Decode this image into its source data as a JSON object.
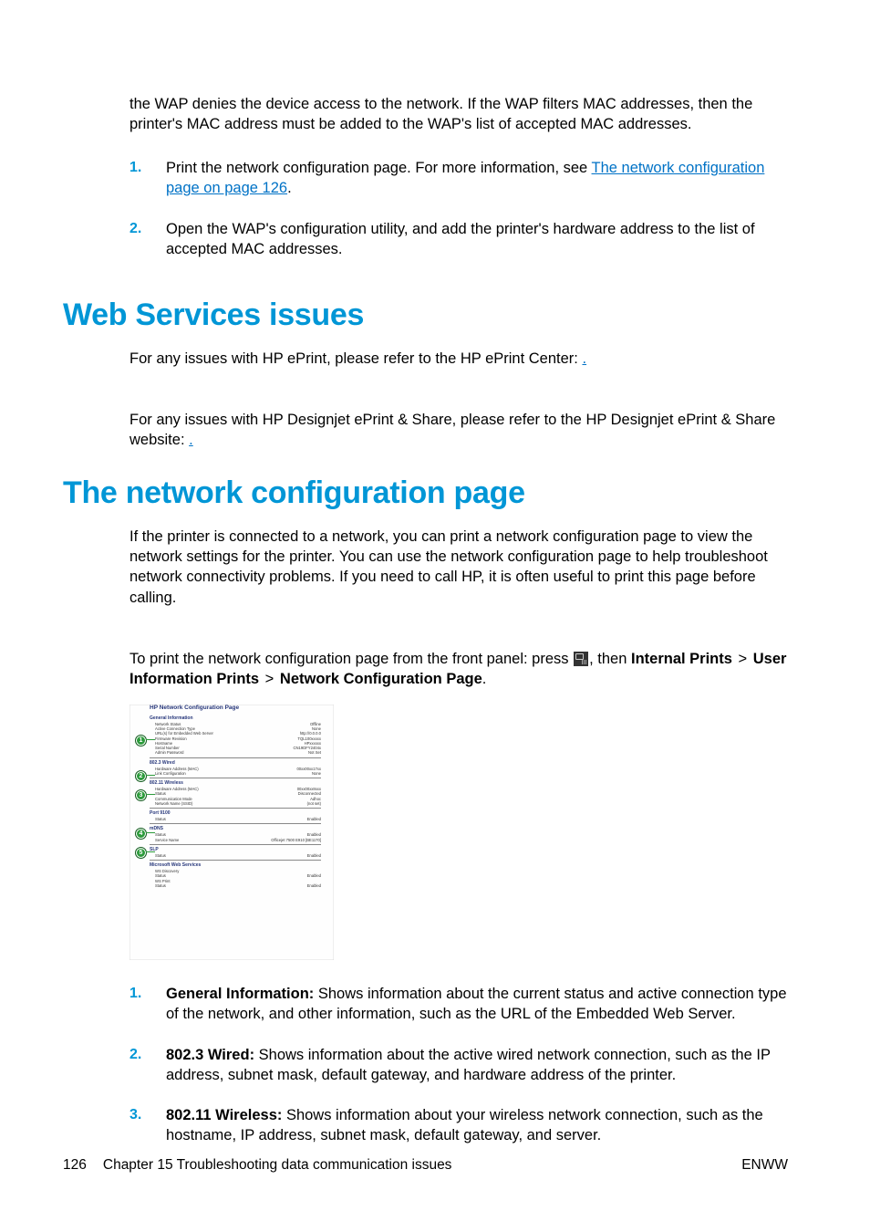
{
  "intro": {
    "p1": "the WAP denies the device access to the network. If the WAP filters MAC addresses, then the printer's MAC address must be added to the WAP's list of accepted MAC addresses.",
    "steps": [
      {
        "marker": "1.",
        "before_link": "Print the network configuration page. For more information, see ",
        "link": "The network configuration page on page 126",
        "after_link": "."
      },
      {
        "marker": "2.",
        "text": "Open the WAP's configuration utility, and add the printer's hardware address to the list of accepted MAC addresses."
      }
    ]
  },
  "web_services": {
    "heading": "Web Services issues",
    "p1_before": "For any issues with HP ePrint, please refer to the HP ePrint Center: ",
    "p1_link": ".",
    "p2_before": "For any issues with HP Designjet ePrint & Share, please refer to the HP Designjet ePrint & Share website: ",
    "p2_link": "."
  },
  "net_cfg": {
    "heading": "The network configuration page",
    "p1": "If the printer is connected to a network, you can print a network configuration page to view the network settings for the printer. You can use the network configuration page to help troubleshoot network connectivity problems. If you need to call HP, it is often useful to print this page before calling.",
    "p2_before": "To print the network configuration page from the front panel: press ",
    "p2_after_icon": ", then ",
    "p2_internal_prints": "Internal Prints",
    "p2_gt1": " > ",
    "p2_user_info": "User Information Prints",
    "p2_gt2": " > ",
    "p2_ncp": "Network Configuration Page",
    "p2_period": "."
  },
  "screenshot": {
    "title": "HP Network Configuration Page",
    "sections": [
      {
        "callout": "1",
        "head": "General Information",
        "rows": [
          [
            "Network Status",
            "Offline"
          ],
          [
            "Active Connection Type",
            "None"
          ],
          [
            "URL(s) for Embedded Web Server",
            "http://0.0.0.0"
          ],
          [
            "Firmware Revision",
            "TQL100xxxxx"
          ],
          [
            "Hostname",
            "HPxxxxxx"
          ],
          [
            "Serial Number",
            "CN19DFY2404x"
          ],
          [
            "Admin Password",
            "Not Set"
          ]
        ]
      },
      {
        "callout": "2",
        "head": "802.3 Wired",
        "rows": [
          [
            "Hardware Address (MAC)",
            "00xx00xx17xx"
          ],
          [
            "Link Configuration",
            "None"
          ]
        ]
      },
      {
        "callout": "3",
        "head": "802.11 Wireless",
        "rows": [
          [
            "Hardware Address (MAC)",
            "00xx00xx8xxx"
          ],
          [
            "Status",
            "Disconnected"
          ],
          [
            "Communication Mode",
            "Adhoc"
          ],
          [
            "Network Name (SSID)",
            "(not set)"
          ]
        ]
      },
      {
        "callout": "",
        "head": "Port 9100",
        "rows": [
          [
            "Status",
            "Enabled"
          ]
        ]
      },
      {
        "callout": "4",
        "head": "mDNS",
        "rows": [
          [
            "Status",
            "Enabled"
          ],
          [
            "Service Name",
            "Officejet 7500 E910 [BE1170]"
          ]
        ]
      },
      {
        "callout": "5",
        "head": "SLP",
        "rows": [
          [
            "Status",
            "Enabled"
          ]
        ]
      },
      {
        "callout": "",
        "head": "Microsoft Web Services",
        "rows": [
          [
            "WS Discovery",
            ""
          ],
          [
            "Status",
            "Enabled"
          ],
          [
            "WS Print",
            ""
          ],
          [
            "Status",
            "Enabled"
          ]
        ]
      }
    ]
  },
  "legend": [
    {
      "marker": "1.",
      "bold": "General Information:",
      "text": " Shows information about the current status and active connection type of the network, and other information, such as the URL of the Embedded Web Server."
    },
    {
      "marker": "2.",
      "bold": "802.3 Wired:",
      "text": " Shows information about the active wired network connection, such as the IP address, subnet mask, default gateway, and hardware address of the printer."
    },
    {
      "marker": "3.",
      "bold": "802.11 Wireless:",
      "text": " Shows information about your wireless network connection, such as the hostname, IP address, subnet mask, default gateway, and server."
    }
  ],
  "footer": {
    "page": "126",
    "chapter": "Chapter 15   Troubleshooting data communication issues",
    "lang": "ENWW"
  }
}
